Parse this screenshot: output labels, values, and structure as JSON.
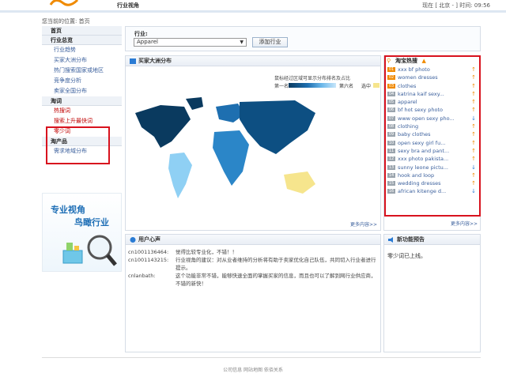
{
  "header": {
    "title": "行业视角",
    "location_time": "现在 [ 北京 - ] 时间: 09:56"
  },
  "breadcrumb": "您当前的位置: 首页",
  "sidebar": {
    "home": "首页",
    "sections": [
      {
        "heading": "行业总览",
        "items": [
          "行业趋势",
          "买家大洲分布",
          "热门搜索国家或地区",
          "竞争度分析",
          "卖家全国分布"
        ]
      },
      {
        "heading": "淘词",
        "items": [
          "热搜词",
          "搜索上升最快词",
          "零少词"
        ]
      },
      {
        "heading": "淘产品",
        "items": [
          "需求地域分布"
        ]
      }
    ]
  },
  "promo": {
    "line1": "专业视角",
    "line2": "鸟瞰行业"
  },
  "filter": {
    "label": "行业:",
    "selected": "Apparel",
    "add_button": "添加行业"
  },
  "map_panel": {
    "title": "买家大洲分布",
    "hint": "鼠标经过区域可显示分布排名及占比",
    "legend_first": "第一名",
    "legend_last": "第六名",
    "legend_selected": "选中",
    "more": "更多内容>>"
  },
  "hot_panel": {
    "title": "淘宝热搜",
    "items": [
      {
        "rank": "01",
        "term": "xxx bf photo",
        "trend": "up"
      },
      {
        "rank": "02",
        "term": "women dresses",
        "trend": "up"
      },
      {
        "rank": "03",
        "term": "clothes",
        "trend": "up"
      },
      {
        "rank": "04",
        "term": "katrina kaif sexy...",
        "trend": "up"
      },
      {
        "rank": "05",
        "term": "apparel",
        "trend": "up"
      },
      {
        "rank": "06",
        "term": "bf hot sexy photo",
        "trend": "up"
      },
      {
        "rank": "07",
        "term": "www open sexy pho...",
        "trend": "down"
      },
      {
        "rank": "08",
        "term": "clothing",
        "trend": "up"
      },
      {
        "rank": "09",
        "term": "baby clothes",
        "trend": "up"
      },
      {
        "rank": "10",
        "term": "open sexy girl fu...",
        "trend": "up"
      },
      {
        "rank": "11",
        "term": "sexy bra and pant...",
        "trend": "up"
      },
      {
        "rank": "12",
        "term": "xxx photo pakista...",
        "trend": "up"
      },
      {
        "rank": "13",
        "term": "sunny leone pictu...",
        "trend": "down"
      },
      {
        "rank": "14",
        "term": "hook and loop",
        "trend": "up"
      },
      {
        "rank": "15",
        "term": "wedding dresses",
        "trend": "up"
      },
      {
        "rank": "16",
        "term": "african kitenge d...",
        "trend": "down"
      }
    ],
    "more": "更多内容>>"
  },
  "voice_panel": {
    "title": "用户心声",
    "entries": [
      {
        "user": "cn1001136464:",
        "text": "觉得比较专业化，不错！！"
      },
      {
        "user": "cn1001143215:",
        "text": "行业视角的建议：对从业者维持的分析将有助于卖家优化自己队伍，共同切入行业者进行提示。"
      },
      {
        "user": "cnlanbath:",
        "text": "这个功能非常不错，能够快速全面的掌握买家的信息，而且也可以了解到网行业供应商，不错的新快！"
      }
    ]
  },
  "notice_panel": {
    "title": "新功能预告",
    "text": "零少词已上线。"
  },
  "footer": "公司信息  网站地图  依佰关系",
  "colors": {
    "accent": "#f08a00",
    "alert": "#d8121e",
    "link": "#3a5f9c",
    "map_dark": "#0a3a5f"
  }
}
